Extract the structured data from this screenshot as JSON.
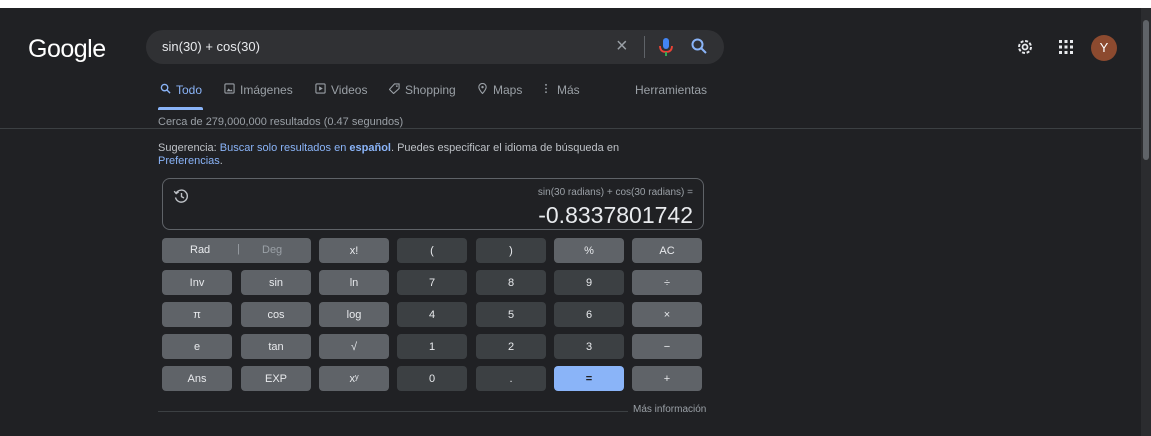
{
  "header": {
    "logo": "Google",
    "query": "sin(30) + cos(30)",
    "clear_glyph": "×",
    "avatar_letter": "Y"
  },
  "icons": {
    "clear": "close-icon",
    "mic": "microphone-icon",
    "search": "search-icon",
    "settings": "gear-icon",
    "apps": "apps-grid-icon",
    "history": "history-icon"
  },
  "tabs": [
    {
      "label": "Todo",
      "icon": "search-icon",
      "active": true
    },
    {
      "label": "Imágenes",
      "icon": "image-icon"
    },
    {
      "label": "Videos",
      "icon": "video-icon"
    },
    {
      "label": "Shopping",
      "icon": "tag-icon"
    },
    {
      "label": "Maps",
      "icon": "map-pin-icon"
    },
    {
      "label": "Más",
      "icon": "more-vert-icon"
    },
    {
      "label": "Herramientas"
    }
  ],
  "results": {
    "stats": "Cerca de 279,000,000 resultados (0.47 segundos)",
    "suggest_prefix": "Sugerencia: ",
    "suggest_link": "Buscar solo resultados en ",
    "suggest_link_bold": "español",
    "suggest_mid": ". Puedes especificar el idioma de búsqueda en ",
    "suggest_pref": "Preferencias",
    "suggest_end": "."
  },
  "calculator": {
    "expression": "sin(30 radians) + cos(30 radians) =",
    "result": "-0.8337801742",
    "rad": "Rad",
    "separator": "|",
    "deg": "Deg",
    "keys": [
      [
        "x!",
        "(",
        ")",
        "%",
        "AC"
      ],
      [
        "Inv",
        "sin",
        "ln",
        "7",
        "8",
        "9",
        "÷"
      ],
      [
        "π",
        "cos",
        "log",
        "4",
        "5",
        "6",
        "×"
      ],
      [
        "e",
        "tan",
        "√",
        "1",
        "2",
        "3",
        "−"
      ],
      [
        "Ans",
        "EXP",
        "xʸ",
        "0",
        ".",
        "=",
        "+"
      ]
    ],
    "more_info": "Más información"
  },
  "colors": {
    "background": "#202124",
    "accent": "#8ab4f8",
    "function_key": "#5f6368",
    "number_key": "#3c4043"
  }
}
